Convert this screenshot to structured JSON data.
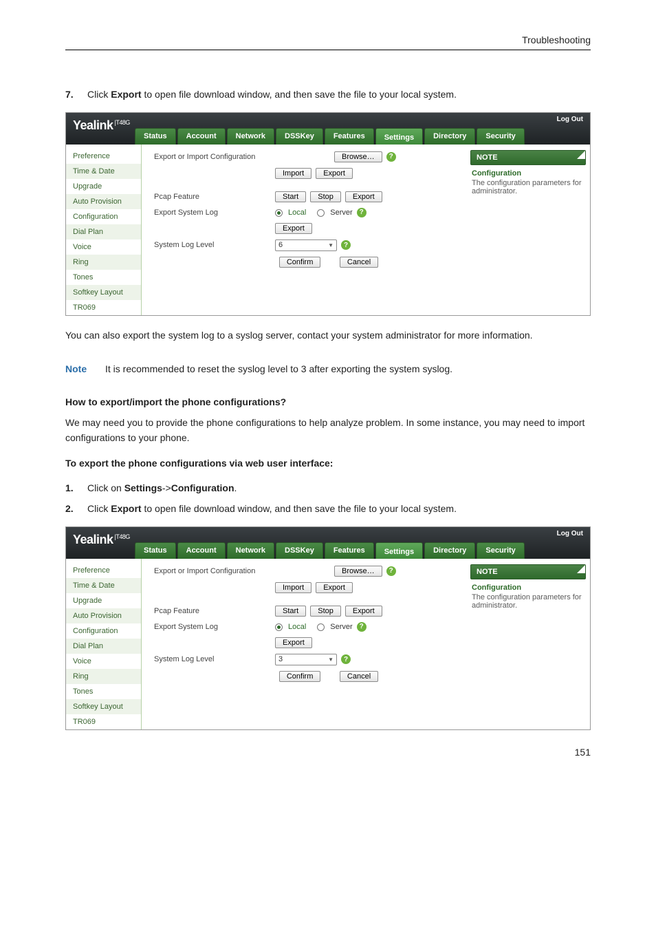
{
  "header": {
    "title": "Troubleshooting"
  },
  "step7": {
    "num": "7.",
    "text_a": "Click ",
    "bold_a": "Export",
    "text_b": " to open file download window, and then save the file to your local system."
  },
  "para_after_panel1": "You can also export the system log to a syslog server, contact your system administrator for more information.",
  "note": {
    "label": "Note",
    "text": "It is recommended to reset the syslog level to 3 after exporting the system syslog."
  },
  "subhead1": "How to export/import the phone configurations?",
  "para2": "We may need you to provide the phone configurations to help analyze problem. In some instance, you may need to import configurations to your phone.",
  "subhead2": "To export the phone configurations via web user interface:",
  "step1": {
    "num": "1.",
    "a": "Click on ",
    "b": "Settings",
    "c": "->",
    "d": "Configuration",
    "e": "."
  },
  "step2": {
    "num": "2.",
    "a": "Click ",
    "b": "Export",
    "c": " to open file download window, and then save the file to your local system."
  },
  "page_num": "151",
  "yealink": {
    "brand": "Yealink",
    "model": "T48G",
    "logout": "Log Out",
    "tabs": [
      "Status",
      "Account",
      "Network",
      "DSSKey",
      "Features",
      "Settings",
      "Directory",
      "Security"
    ],
    "active_tab": "Settings",
    "side": [
      "Preference",
      "Time & Date",
      "Upgrade",
      "Auto Provision",
      "Configuration",
      "Dial Plan",
      "Voice",
      "Ring",
      "Tones",
      "Softkey Layout",
      "TR069"
    ],
    "labels": {
      "export_import": "Export or Import Configuration",
      "pcap": "Pcap Feature",
      "export_syslog": "Export System Log",
      "syslog_level": "System Log Level"
    },
    "buttons": {
      "browse": "Browse…",
      "import": "Import",
      "export": "Export",
      "start": "Start",
      "stop": "Stop",
      "confirm": "Confirm",
      "cancel": "Cancel"
    },
    "radio": {
      "local": "Local",
      "server": "Server"
    },
    "notebox": {
      "title": "NOTE",
      "subtitle": "Configuration",
      "body": "The configuration parameters for administrator."
    }
  },
  "panel1": {
    "syslog_level_value": "6"
  },
  "panel2": {
    "syslog_level_value": "3"
  }
}
